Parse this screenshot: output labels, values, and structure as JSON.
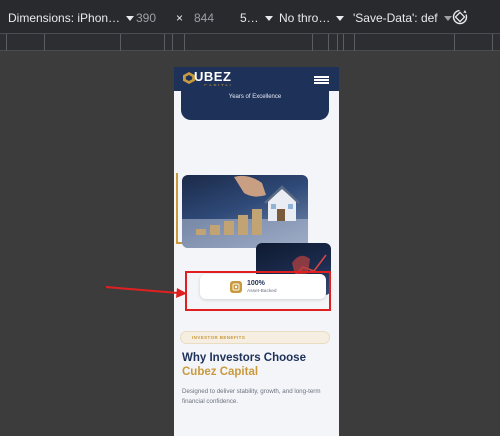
{
  "devtools": {
    "device_select": "Dimensions: iPhon…",
    "width_value": "390",
    "times_symbol": "×",
    "height_value": "844",
    "zoom_select": "5…",
    "throttle_select": "No thro…",
    "save_data_select": "'Save-Data': def",
    "rotate_icon": "rotate-icon"
  },
  "site": {
    "logo_text": "UBEZ",
    "logo_sub": "CAPITAL",
    "hero_card_text": "Years of Excellence",
    "stat": {
      "value": "100%",
      "label": "Asset-Backed"
    },
    "section_pill": "INVESTOR BENEFITS",
    "headline_line1": "Why Investors Choose",
    "headline_line2": "Cubez Capital",
    "body": "Designed to deliver stability, growth, and long-term financial confidence."
  },
  "colors": {
    "navy": "#1d3159",
    "gold": "#c99a3d",
    "annotation_red": "#e02020"
  }
}
